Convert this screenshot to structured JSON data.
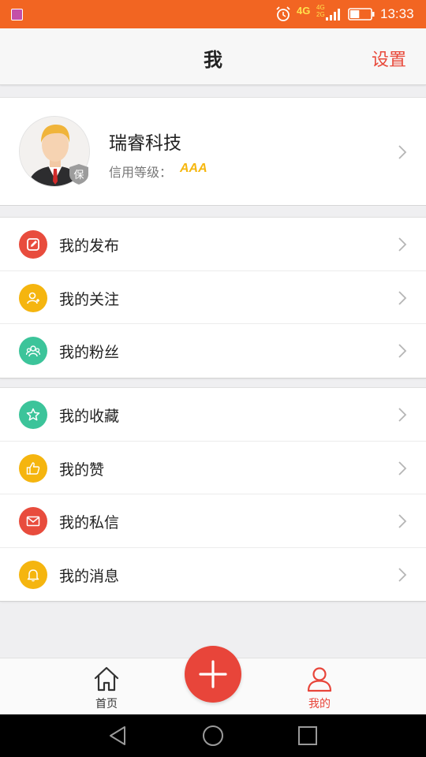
{
  "status_bar": {
    "network": "4G",
    "network_small_top": "4G",
    "network_small_bottom": "2G",
    "time": "13:33",
    "battery_percent": 45,
    "icons": [
      "app-notification-icon",
      "alarm-icon",
      "signal-icon",
      "battery-icon"
    ]
  },
  "header": {
    "title": "我",
    "settings_label": "设置"
  },
  "profile": {
    "name": "瑞睿科技",
    "credit_label": "信用等级：",
    "credit_value": "AAA",
    "badge_text": "保"
  },
  "menu_groups": [
    {
      "items": [
        {
          "label": "我的发布",
          "icon": "edit-icon",
          "color": "#e84c3d"
        },
        {
          "label": "我的关注",
          "icon": "add-user-icon",
          "color": "#f5b50f"
        },
        {
          "label": "我的粉丝",
          "icon": "group-icon",
          "color": "#3cc49a"
        }
      ]
    },
    {
      "items": [
        {
          "label": "我的收藏",
          "icon": "star-icon",
          "color": "#3cc49a"
        },
        {
          "label": "我的赞",
          "icon": "thumbs-up-icon",
          "color": "#f5b50f"
        },
        {
          "label": "我的私信",
          "icon": "mail-icon",
          "color": "#e84c3d"
        },
        {
          "label": "我的消息",
          "icon": "bell-icon",
          "color": "#f5b50f"
        }
      ]
    }
  ],
  "tabbar": {
    "home_label": "首页",
    "mine_label": "我的",
    "active_color": "#e8453a",
    "inactive_color": "#333333"
  },
  "colors": {
    "status_bar": "#f26522",
    "accent": "#e8453a",
    "credit": "#f6b70f"
  }
}
